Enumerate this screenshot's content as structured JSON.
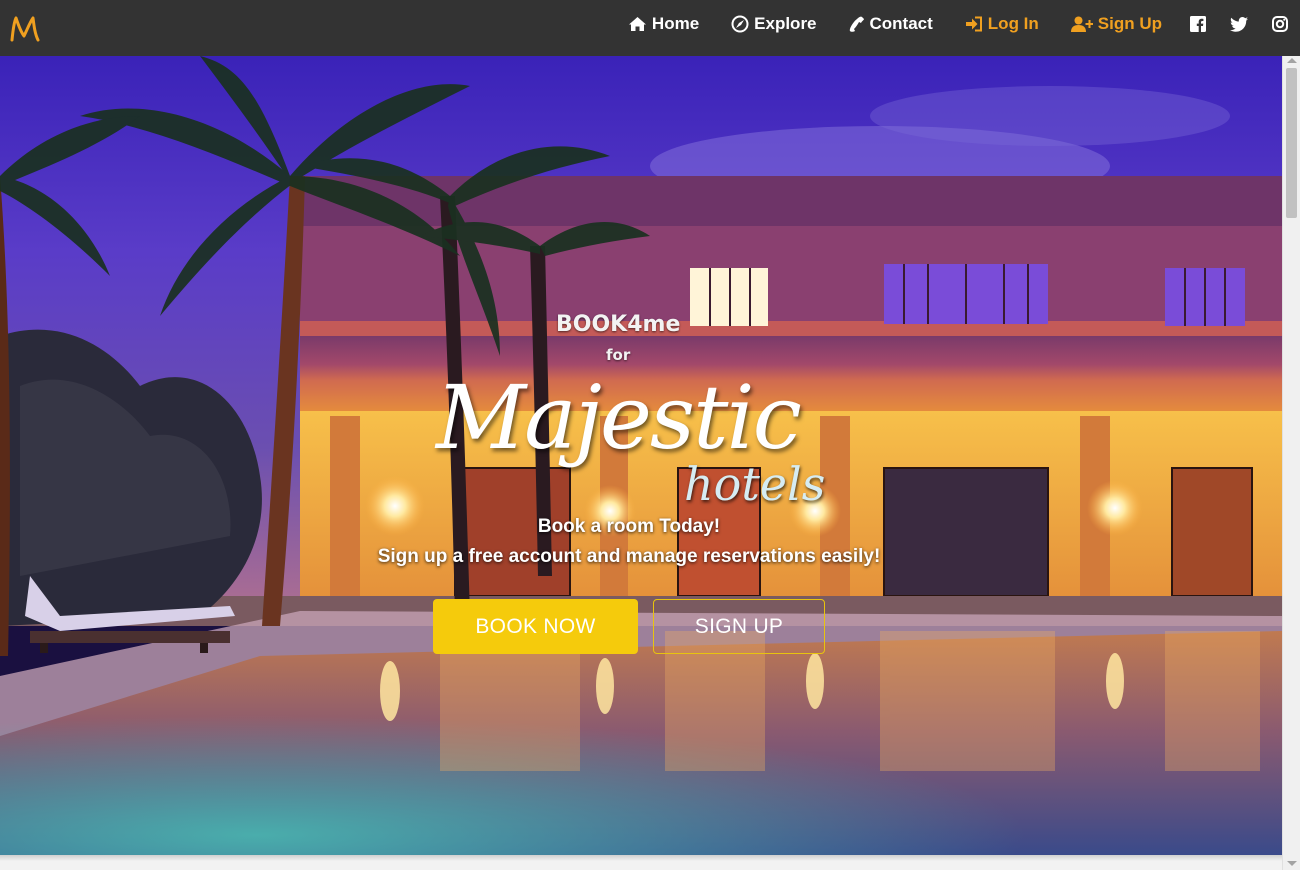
{
  "colors": {
    "navbar_bg": "#333333",
    "nav_text": "#ffffff",
    "nav_accent": "#f0a020",
    "book_button": "#f5cb0c",
    "signup_border": "#e8c40e"
  },
  "brand": {
    "logo_icon": "m-logo-icon"
  },
  "nav": {
    "home": {
      "label": "Home",
      "icon": "home-icon"
    },
    "explore": {
      "label": "Explore",
      "icon": "compass-icon"
    },
    "contact": {
      "label": "Contact",
      "icon": "phone-icon"
    },
    "login": {
      "label": "Log In",
      "icon": "sign-in-icon"
    },
    "signup": {
      "label": "Sign Up",
      "icon": "user-plus-icon"
    },
    "social": [
      "facebook-icon",
      "twitter-icon",
      "instagram-icon"
    ]
  },
  "hero": {
    "logo_line1": "BOOK4me",
    "logo_line2": "for",
    "logo_main": "Majestic",
    "logo_sub": "hotels",
    "tagline_1": "Book a room Today!",
    "tagline_2": "Sign up a free account and manage reservations easily!",
    "book_button": "BOOK NOW",
    "signup_button": "SIGN UP"
  }
}
